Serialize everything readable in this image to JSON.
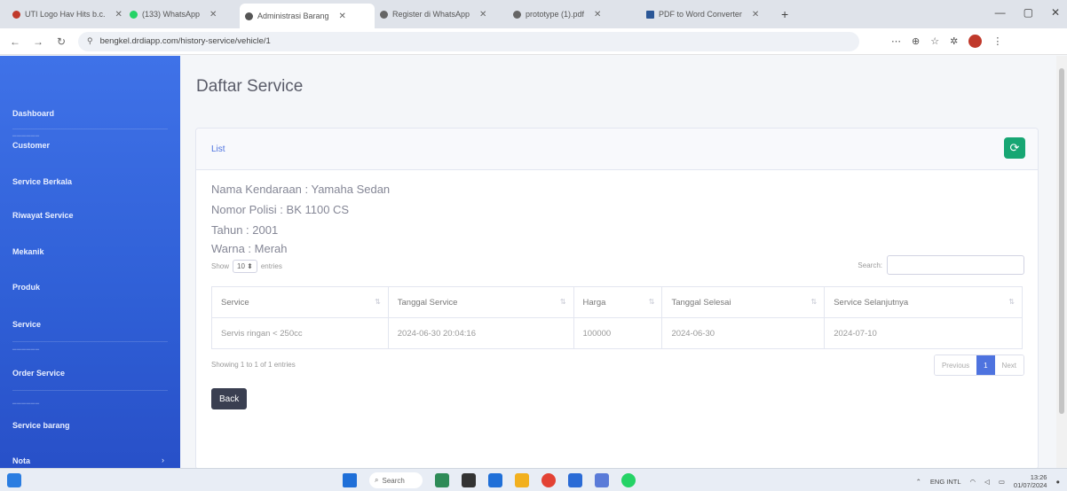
{
  "browser": {
    "tabs": [
      {
        "label": "UTI Logo Hav Hits b.c.",
        "color": "#c0392b",
        "active": false
      },
      {
        "label": "(133) WhatsApp",
        "color": "#25d366",
        "active": false
      },
      {
        "label": "Administrasi Barang",
        "color": "#555555",
        "active": true
      },
      {
        "label": "Register di WhatsApp",
        "color": "#666666",
        "active": false
      },
      {
        "label": "prototype (1).pdf",
        "color": "#666666",
        "active": false
      },
      {
        "label": "PDF to Word Converter",
        "color": "#2b5797",
        "active": false
      }
    ],
    "new_tab": "+",
    "url": "bengkel.drdiapp.com/history-service/vehicle/1",
    "window_controls": [
      "—",
      "▢",
      "✕"
    ]
  },
  "sidebar": {
    "items": [
      {
        "label": "Dashboard",
        "top": 0
      },
      {
        "label": "Customer"
      },
      {
        "label": "Service Berkala"
      },
      {
        "label": "Riwayat Service"
      },
      {
        "label": "Mekanik"
      },
      {
        "label": "Produk"
      },
      {
        "label": "Service"
      },
      {
        "label": "Order Service"
      },
      {
        "label": "Service barang"
      },
      {
        "label": "Nota"
      }
    ]
  },
  "page": {
    "title": "Daftar Service",
    "card_title": "List",
    "vehicle": {
      "name_line": "Nama Kendaraan : Yamaha Sedan",
      "plate_line": "Nomor Polisi : BK 1100 CS",
      "year_line": "Tahun : 2001",
      "color_line": "Warna : Merah"
    },
    "table": {
      "length_prefix": "Show",
      "length_value": "10",
      "length_suffix": "entries",
      "search_label": "Search:",
      "search_value": "",
      "columns": [
        "Service",
        "Tanggal Service",
        "Harga",
        "Tanggal Selesai",
        "Service Selanjutnya"
      ],
      "rows": [
        [
          "Servis ringan < 250cc",
          "2024-06-30 20:04:16",
          "100000",
          "2024-06-30",
          "2024-07-10"
        ]
      ],
      "info": "Showing 1 to 1 of 1 entries",
      "pager": {
        "prev": "Previous",
        "current": "1",
        "next": "Next"
      }
    },
    "back_label": "Back"
  },
  "taskbar": {
    "search_label": "Search",
    "tray_lang": "ENG INTL",
    "tray_time": "13:26",
    "tray_date": "01/07/2024"
  }
}
